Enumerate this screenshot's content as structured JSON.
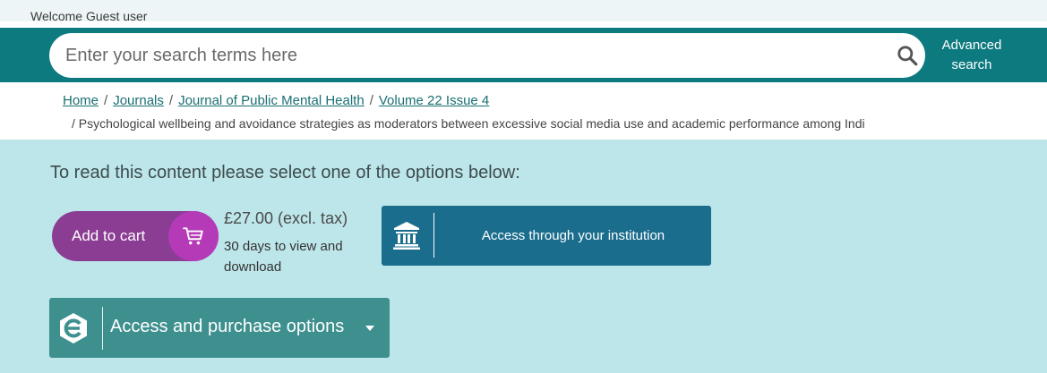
{
  "welcome": {
    "text": "Welcome Guest user"
  },
  "search": {
    "placeholder": "Enter your search terms here",
    "icon": "search-icon",
    "advanced_line1": "Advanced",
    "advanced_line2": "search"
  },
  "breadcrumb": {
    "items": [
      "Home",
      "Journals",
      "Journal of Public Mental Health",
      "Volume 22 Issue 4"
    ],
    "separator": "/",
    "current": "/ Psychological wellbeing and avoidance strategies as moderators between excessive social media use and academic performance among Indi"
  },
  "access": {
    "prompt": "To read this content please select one of the options below:",
    "cart_label": "Add to cart",
    "cart_icon": "cart-icon",
    "price": "£27.00 (excl. tax)",
    "price_note": "30 days to view and download",
    "institution_label": "Access through your institution",
    "institution_icon": "institution-icon",
    "purchase_label": "Access and purchase options",
    "purchase_icon": "publisher-logo-icon"
  },
  "colors": {
    "search_band": "#0d7a80",
    "panel_bg": "#bde6ea",
    "cart_purple": "#8a3d93",
    "cart_circle": "#b53ab7",
    "institution_btn": "#1b6d8e",
    "purchase_btn": "#3e908f"
  }
}
